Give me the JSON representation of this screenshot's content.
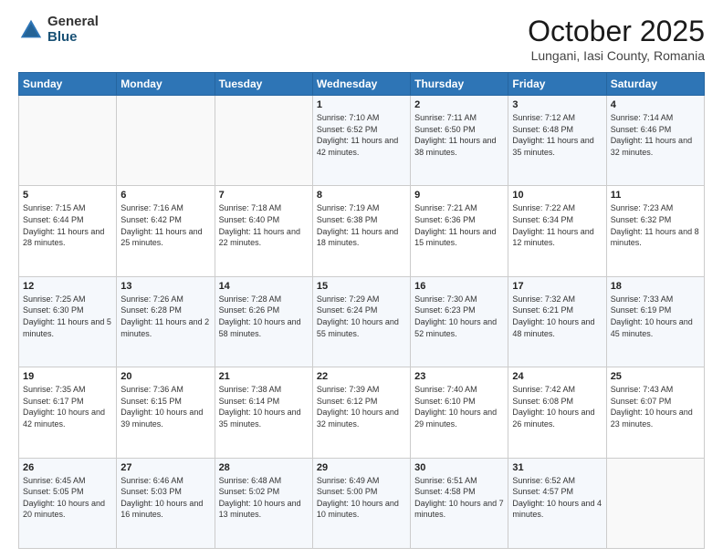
{
  "header": {
    "logo_general": "General",
    "logo_blue": "Blue",
    "month_title": "October 2025",
    "location": "Lungani, Iasi County, Romania"
  },
  "days_of_week": [
    "Sunday",
    "Monday",
    "Tuesday",
    "Wednesday",
    "Thursday",
    "Friday",
    "Saturday"
  ],
  "weeks": [
    [
      {
        "day": "",
        "info": ""
      },
      {
        "day": "",
        "info": ""
      },
      {
        "day": "",
        "info": ""
      },
      {
        "day": "1",
        "info": "Sunrise: 7:10 AM\nSunset: 6:52 PM\nDaylight: 11 hours and 42 minutes."
      },
      {
        "day": "2",
        "info": "Sunrise: 7:11 AM\nSunset: 6:50 PM\nDaylight: 11 hours and 38 minutes."
      },
      {
        "day": "3",
        "info": "Sunrise: 7:12 AM\nSunset: 6:48 PM\nDaylight: 11 hours and 35 minutes."
      },
      {
        "day": "4",
        "info": "Sunrise: 7:14 AM\nSunset: 6:46 PM\nDaylight: 11 hours and 32 minutes."
      }
    ],
    [
      {
        "day": "5",
        "info": "Sunrise: 7:15 AM\nSunset: 6:44 PM\nDaylight: 11 hours and 28 minutes."
      },
      {
        "day": "6",
        "info": "Sunrise: 7:16 AM\nSunset: 6:42 PM\nDaylight: 11 hours and 25 minutes."
      },
      {
        "day": "7",
        "info": "Sunrise: 7:18 AM\nSunset: 6:40 PM\nDaylight: 11 hours and 22 minutes."
      },
      {
        "day": "8",
        "info": "Sunrise: 7:19 AM\nSunset: 6:38 PM\nDaylight: 11 hours and 18 minutes."
      },
      {
        "day": "9",
        "info": "Sunrise: 7:21 AM\nSunset: 6:36 PM\nDaylight: 11 hours and 15 minutes."
      },
      {
        "day": "10",
        "info": "Sunrise: 7:22 AM\nSunset: 6:34 PM\nDaylight: 11 hours and 12 minutes."
      },
      {
        "day": "11",
        "info": "Sunrise: 7:23 AM\nSunset: 6:32 PM\nDaylight: 11 hours and 8 minutes."
      }
    ],
    [
      {
        "day": "12",
        "info": "Sunrise: 7:25 AM\nSunset: 6:30 PM\nDaylight: 11 hours and 5 minutes."
      },
      {
        "day": "13",
        "info": "Sunrise: 7:26 AM\nSunset: 6:28 PM\nDaylight: 11 hours and 2 minutes."
      },
      {
        "day": "14",
        "info": "Sunrise: 7:28 AM\nSunset: 6:26 PM\nDaylight: 10 hours and 58 minutes."
      },
      {
        "day": "15",
        "info": "Sunrise: 7:29 AM\nSunset: 6:24 PM\nDaylight: 10 hours and 55 minutes."
      },
      {
        "day": "16",
        "info": "Sunrise: 7:30 AM\nSunset: 6:23 PM\nDaylight: 10 hours and 52 minutes."
      },
      {
        "day": "17",
        "info": "Sunrise: 7:32 AM\nSunset: 6:21 PM\nDaylight: 10 hours and 48 minutes."
      },
      {
        "day": "18",
        "info": "Sunrise: 7:33 AM\nSunset: 6:19 PM\nDaylight: 10 hours and 45 minutes."
      }
    ],
    [
      {
        "day": "19",
        "info": "Sunrise: 7:35 AM\nSunset: 6:17 PM\nDaylight: 10 hours and 42 minutes."
      },
      {
        "day": "20",
        "info": "Sunrise: 7:36 AM\nSunset: 6:15 PM\nDaylight: 10 hours and 39 minutes."
      },
      {
        "day": "21",
        "info": "Sunrise: 7:38 AM\nSunset: 6:14 PM\nDaylight: 10 hours and 35 minutes."
      },
      {
        "day": "22",
        "info": "Sunrise: 7:39 AM\nSunset: 6:12 PM\nDaylight: 10 hours and 32 minutes."
      },
      {
        "day": "23",
        "info": "Sunrise: 7:40 AM\nSunset: 6:10 PM\nDaylight: 10 hours and 29 minutes."
      },
      {
        "day": "24",
        "info": "Sunrise: 7:42 AM\nSunset: 6:08 PM\nDaylight: 10 hours and 26 minutes."
      },
      {
        "day": "25",
        "info": "Sunrise: 7:43 AM\nSunset: 6:07 PM\nDaylight: 10 hours and 23 minutes."
      }
    ],
    [
      {
        "day": "26",
        "info": "Sunrise: 6:45 AM\nSunset: 5:05 PM\nDaylight: 10 hours and 20 minutes."
      },
      {
        "day": "27",
        "info": "Sunrise: 6:46 AM\nSunset: 5:03 PM\nDaylight: 10 hours and 16 minutes."
      },
      {
        "day": "28",
        "info": "Sunrise: 6:48 AM\nSunset: 5:02 PM\nDaylight: 10 hours and 13 minutes."
      },
      {
        "day": "29",
        "info": "Sunrise: 6:49 AM\nSunset: 5:00 PM\nDaylight: 10 hours and 10 minutes."
      },
      {
        "day": "30",
        "info": "Sunrise: 6:51 AM\nSunset: 4:58 PM\nDaylight: 10 hours and 7 minutes."
      },
      {
        "day": "31",
        "info": "Sunrise: 6:52 AM\nSunset: 4:57 PM\nDaylight: 10 hours and 4 minutes."
      },
      {
        "day": "",
        "info": ""
      }
    ]
  ]
}
